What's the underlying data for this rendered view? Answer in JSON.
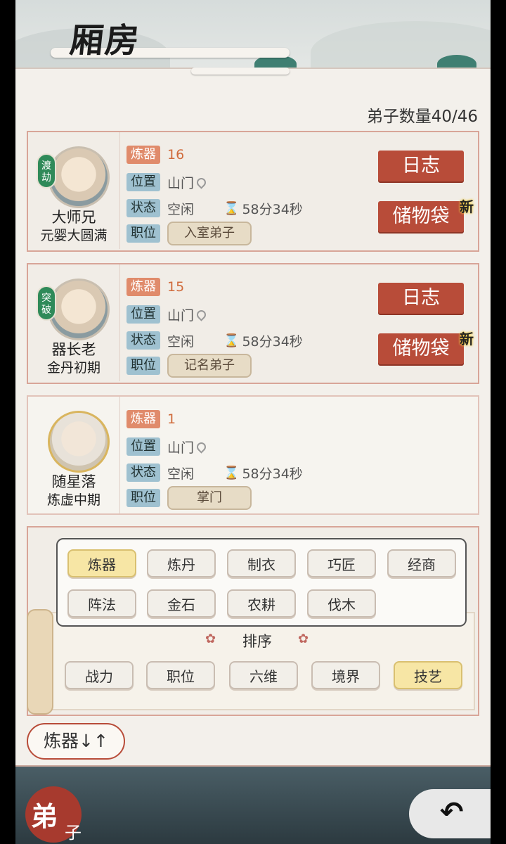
{
  "header": {
    "title": "厢房",
    "disciple_count": "弟子数量40/46"
  },
  "cards": [
    {
      "skill_label": "炼器",
      "skill_value": "16",
      "loc_label": "位置",
      "loc_value": "山门",
      "status_label": "状态",
      "status_value": "空闲",
      "timer": "58分34秒",
      "rank_label": "职位",
      "rank_value": "入室弟子",
      "name": "大师兄",
      "realm": "元婴大圆满",
      "badge": "渡劫",
      "log_button": "日志",
      "bag_button": "储物袋",
      "new_tag": "新"
    },
    {
      "skill_label": "炼器",
      "skill_value": "15",
      "loc_label": "位置",
      "loc_value": "山门",
      "status_label": "状态",
      "status_value": "空闲",
      "timer": "58分34秒",
      "rank_label": "职位",
      "rank_value": "记名弟子",
      "name": "器长老",
      "realm": "金丹初期",
      "badge": "突破",
      "log_button": "日志",
      "bag_button": "储物袋",
      "new_tag": "新"
    },
    {
      "skill_label": "炼器",
      "skill_value": "1",
      "loc_label": "位置",
      "loc_value": "山门",
      "status_label": "状态",
      "status_value": "空闲",
      "timer": "58分34秒",
      "rank_label": "职位",
      "rank_value": "掌门",
      "name": "随星落",
      "realm": "炼虚中期"
    }
  ],
  "filter": {
    "options": [
      "炼器",
      "炼丹",
      "制衣",
      "巧匠",
      "经商",
      "阵法",
      "金石",
      "农耕",
      "伐木"
    ],
    "selected": "炼器"
  },
  "sort": {
    "title": "排序",
    "options": [
      "战力",
      "职位",
      "六维",
      "境界",
      "技艺"
    ],
    "selected": "技艺"
  },
  "sort_button": "炼器↓↑",
  "bottom": {
    "seal_main": "弟",
    "seal_sub": "子",
    "back_icon": "back-arrow"
  },
  "colors": {
    "accent_red": "#b84c39",
    "tag_blue": "#9fc1d0",
    "tag_orange": "#e08b6b",
    "selected_chip": "#f7e6a5"
  }
}
